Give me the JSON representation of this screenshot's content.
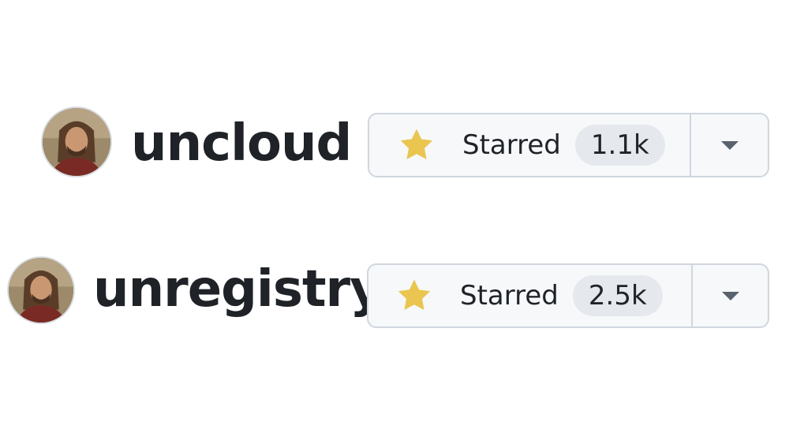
{
  "repos": [
    {
      "name": "uncloud",
      "star_label": "Starred",
      "star_count": "1.1k",
      "starred": true
    },
    {
      "name": "unregistry",
      "star_label": "Starred",
      "star_count": "2.5k",
      "starred": true
    }
  ],
  "colors": {
    "star": "#eac54f",
    "button_bg": "#f6f8fa",
    "border": "#d0d7de",
    "counter_bg": "#e5e9ee",
    "text": "#1f2328",
    "caret": "#59636e"
  },
  "icons": {
    "avatar": "user-avatar",
    "star": "star-filled-icon",
    "dropdown": "triangle-down-icon"
  }
}
